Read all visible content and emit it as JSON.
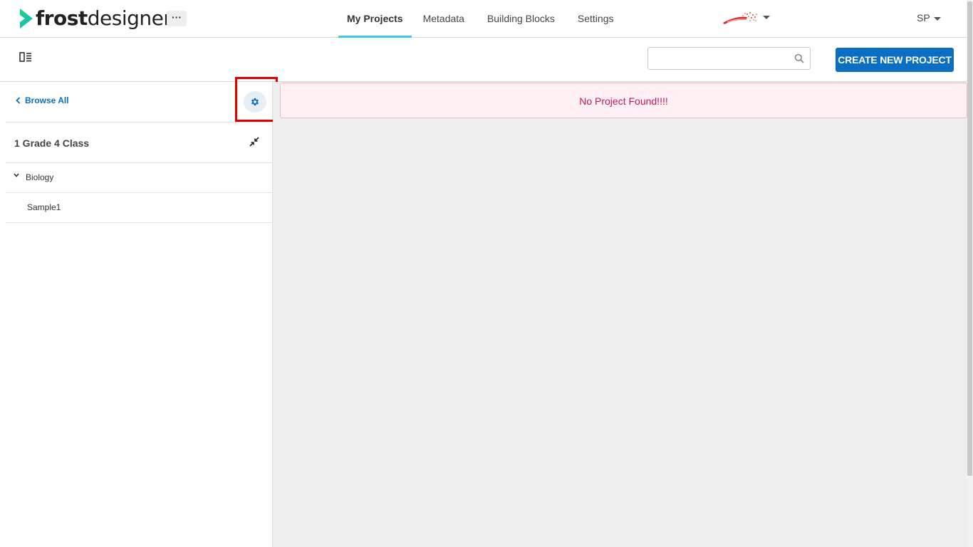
{
  "brand": {
    "logo_bold": "frost",
    "logo_light": "designer",
    "more_label": "···"
  },
  "nav": {
    "items": [
      {
        "label": "My Projects",
        "active": true
      },
      {
        "label": "Metadata",
        "active": false
      },
      {
        "label": "Building Blocks",
        "active": false
      },
      {
        "label": "Settings",
        "active": false
      }
    ]
  },
  "user": {
    "initials": "SP"
  },
  "toolbar": {
    "search_placeholder": "",
    "create_label": "CREATE NEW PROJECT"
  },
  "sidebar": {
    "browse_all": "Browse All",
    "class_title": "1 Grade 4 Class",
    "tree": [
      {
        "label": "Biology",
        "expanded": true
      },
      {
        "label": "Sample1"
      }
    ]
  },
  "main": {
    "alert_text": "No Project Found!!!!"
  },
  "colors": {
    "accent": "#0a6fc2",
    "nav_underline": "#3ec9e8",
    "logo_green": "#19c37d",
    "alert_text": "#c2185b",
    "highlight": "#e00000"
  }
}
